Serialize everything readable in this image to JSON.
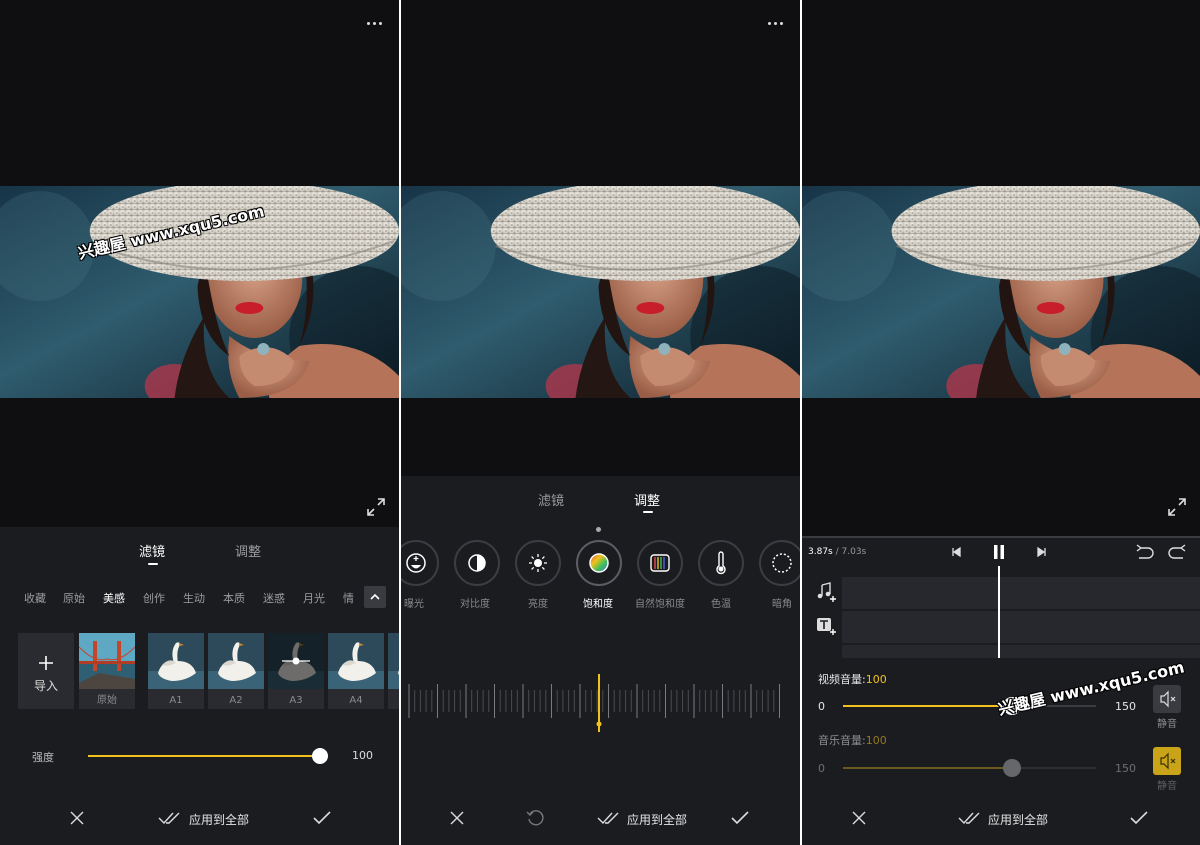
{
  "watermark": "兴趣屋 www.xqu5.com",
  "screen1": {
    "tabs": [
      "滤镜",
      "调整"
    ],
    "categories": [
      "收藏",
      "原始",
      "美感",
      "创作",
      "生动",
      "本质",
      "迷惑",
      "月光",
      "情"
    ],
    "import_label": "导入",
    "filters": [
      "原始",
      "A1",
      "A2",
      "A3",
      "A4"
    ],
    "intensity_label": "强度",
    "intensity_value": "100",
    "intensity_level": 1.0,
    "apply_all": "应用到全部"
  },
  "screen2": {
    "tabs": [
      "滤镜",
      "调整"
    ],
    "tools": [
      "曝光",
      "对比度",
      "亮度",
      "饱和度",
      "自然饱和度",
      "色温",
      "暗角"
    ],
    "selected_tool": "饱和度",
    "apply_all": "应用到全部"
  },
  "screen3": {
    "time_current": "3.87s",
    "time_total": "/ 7.03s",
    "video_volume_label": "视频音量:",
    "video_volume_value": "100",
    "music_volume_label": "音乐音量:",
    "music_volume_value": "100",
    "range_min": "0",
    "range_max": "150",
    "video_volume_level": 0.667,
    "music_volume_level": 0.667,
    "mute_label": "静音",
    "apply_all": "应用到全部"
  },
  "colors": {
    "accent": "#f1c21b",
    "background": "#0f0f11",
    "sheet": "#1b1c20"
  }
}
